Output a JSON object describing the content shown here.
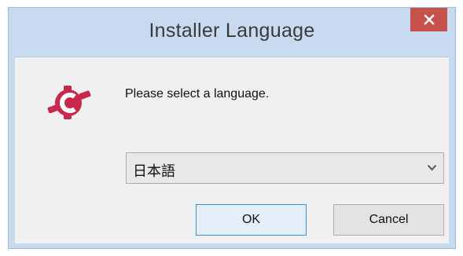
{
  "window": {
    "title": "Installer Language",
    "close_icon": "close-icon",
    "accent_color": "#c7514b"
  },
  "dialog": {
    "app_icon": "installer-logo-icon",
    "prompt": "Please select a language.",
    "language_select": {
      "selected": "日本語",
      "dropdown_icon": "chevron-down-icon"
    },
    "buttons": {
      "ok_label": "OK",
      "cancel_label": "Cancel"
    }
  }
}
